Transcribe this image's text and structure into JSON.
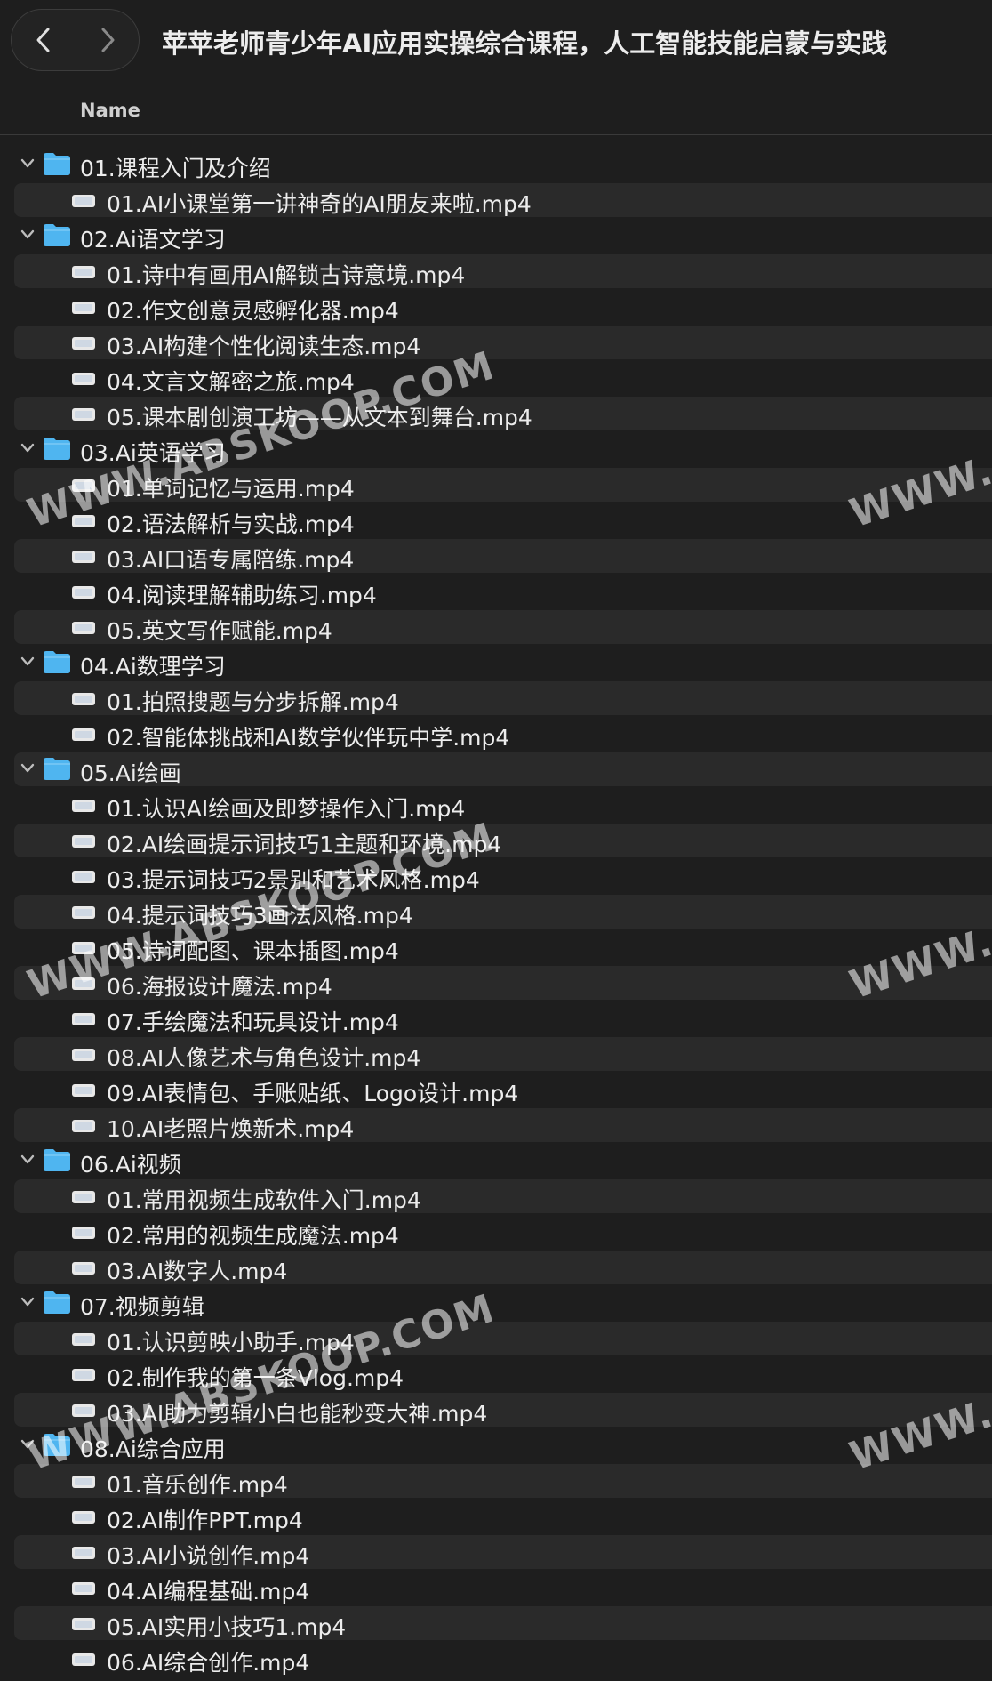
{
  "window": {
    "title": "苹苹老师青少年AI应用实操综合课程，人工智能技能启蒙与实践"
  },
  "toolbar": {
    "back_icon": "chevron-left-icon",
    "forward_icon": "chevron-right-icon"
  },
  "header": {
    "name_column": "Name"
  },
  "watermark": "WWW.ABSKOOP.COM",
  "folders": [
    {
      "name": "01.课程入门及介绍",
      "files": [
        "01.AI小课堂第一讲神奇的AI朋友来啦.mp4"
      ]
    },
    {
      "name": "02.Ai语文学习",
      "files": [
        "01.诗中有画用AI解锁古诗意境.mp4",
        "02.作文创意灵感孵化器.mp4",
        "03.AI构建个性化阅读生态.mp4",
        "04.文言文解密之旅.mp4",
        "05.课本剧创演工坊——从文本到舞台.mp4"
      ]
    },
    {
      "name": "03.Ai英语学习",
      "files": [
        "01.单词记忆与运用.mp4",
        "02.语法解析与实战.mp4",
        "03.AI口语专属陪练.mp4",
        "04.阅读理解辅助练习.mp4",
        "05.英文写作赋能.mp4"
      ]
    },
    {
      "name": "04.Ai数理学习",
      "files": [
        "01.拍照搜题与分步拆解.mp4",
        "02.智能体挑战和AI数学伙伴玩中学.mp4"
      ]
    },
    {
      "name": "05.Ai绘画",
      "files": [
        "01.认识AI绘画及即梦操作入门.mp4",
        "02.AI绘画提示词技巧1主题和环境.mp4",
        "03.提示词技巧2景别和艺术风格.mp4",
        "04.提示词技巧3画法风格.mp4",
        "05.诗词配图、课本插图.mp4",
        "06.海报设计魔法.mp4",
        "07.手绘魔法和玩具设计.mp4",
        "08.AI人像艺术与角色设计.mp4",
        "09.AI表情包、手账贴纸、Logo设计.mp4",
        "10.AI老照片焕新术.mp4"
      ]
    },
    {
      "name": "06.Ai视频",
      "files": [
        "01.常用视频生成软件入门.mp4",
        "02.常用的视频生成魔法.mp4",
        "03.AI数字人.mp4"
      ]
    },
    {
      "name": "07.视频剪辑",
      "files": [
        "01.认识剪映小助手.mp4",
        "02.制作我的第一条Vlog.mp4",
        "03.AI助力剪辑小白也能秒变大神.mp4"
      ]
    },
    {
      "name": "08.Ai综合应用",
      "files": [
        "01.音乐创作.mp4",
        "02.AI制作PPT.mp4",
        "03.AI小说创作.mp4",
        "04.AI编程基础.mp4",
        "05.AI实用小技巧1.mp4",
        "06.AI综合创作.mp4"
      ]
    }
  ],
  "colors": {
    "background": "#1e1e1e",
    "stripe": "#2a2a2a",
    "folder": "#4fb5f0",
    "text": "#ececec"
  }
}
